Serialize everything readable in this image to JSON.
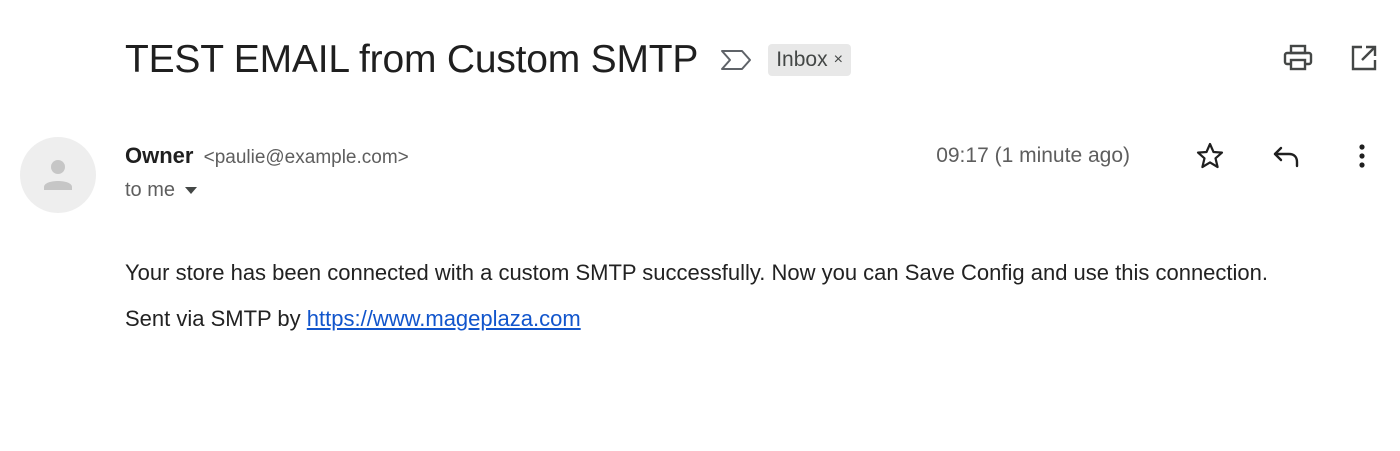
{
  "email": {
    "subject": "TEST EMAIL from Custom SMTP",
    "label": "Inbox",
    "label_remove": "×",
    "sender_name": "Owner",
    "sender_email": "<paulie@example.com>",
    "recipient": "to me",
    "timestamp": "09:17 (1 minute ago)",
    "body_text": "Your store has been connected with a custom SMTP successfully. Now you can Save Config and use this connection.",
    "sent_via_prefix": "Sent via SMTP by ",
    "sent_via_link": "https://www.mageplaza.com"
  },
  "icons": {
    "importance": "importance-marker-icon",
    "print": "print-icon",
    "open_new_window": "open-in-new-window-icon",
    "avatar": "person-avatar-icon",
    "star": "star-icon",
    "reply": "reply-icon",
    "more": "more-vertical-icon",
    "recipient_caret": "caret-down-icon"
  },
  "colors": {
    "link": "#1155cc",
    "chip_bg": "#e8e8e8",
    "muted_text": "#5e5e5e"
  }
}
